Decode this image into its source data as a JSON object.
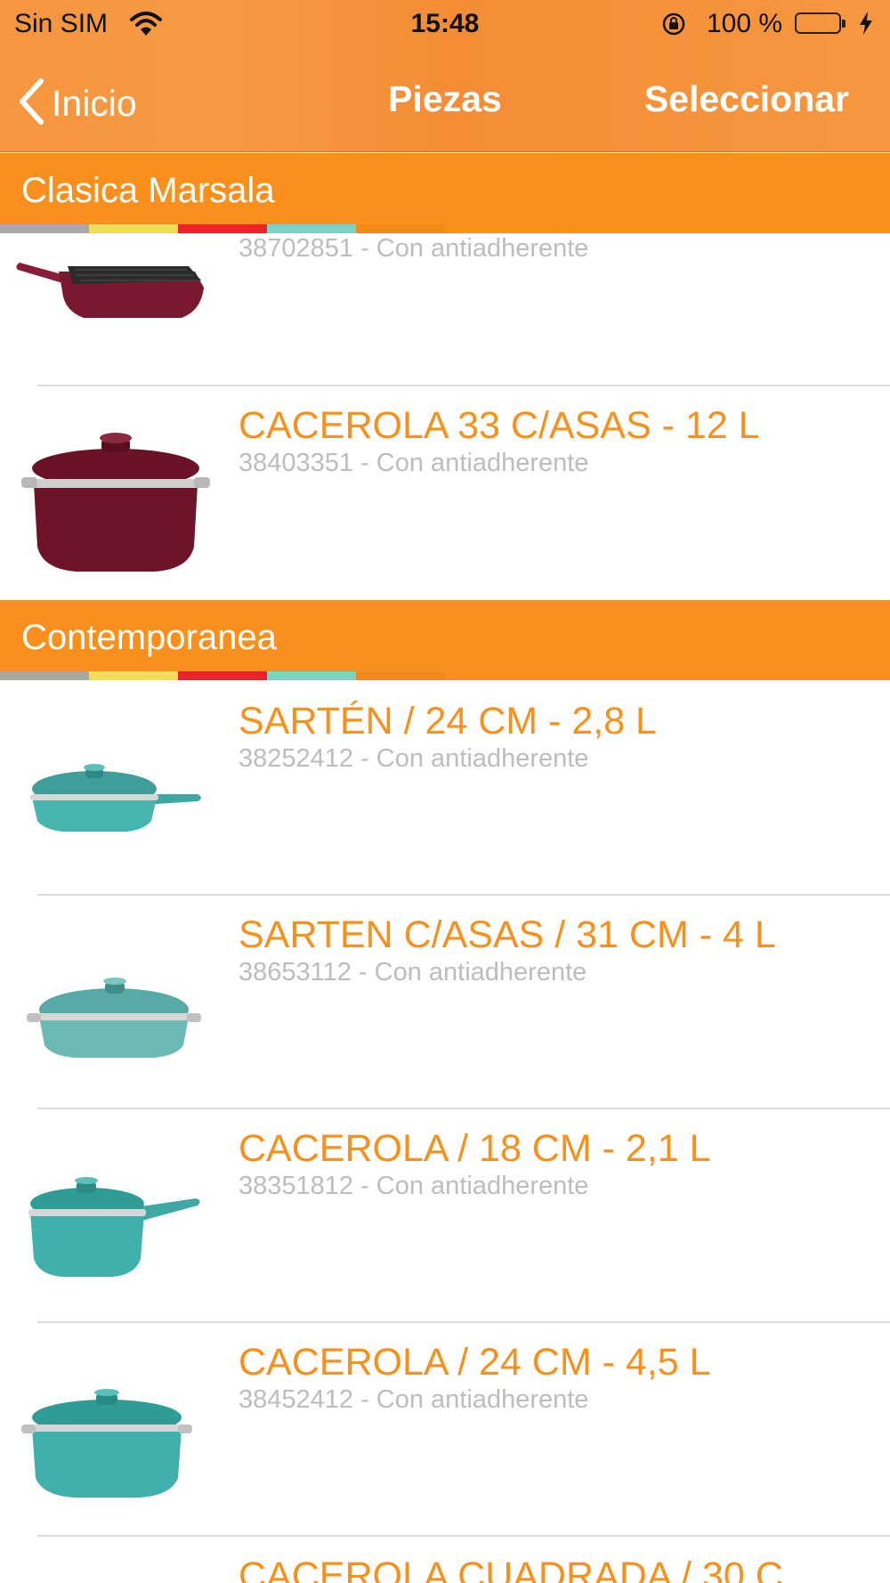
{
  "status_bar": {
    "carrier": "Sin SIM",
    "time": "15:48",
    "battery_percent": "100 %",
    "battery_level": 1.0
  },
  "nav": {
    "back_label": "Inicio",
    "title": "Piezas",
    "select_label": "Seleccionar"
  },
  "colors": {
    "accent": "#f9901d",
    "nav_bar": "#f6963f",
    "product_title": "#f7911e",
    "subtitle_gray": "#bdbdbd",
    "stripes": [
      "#a8a8a8",
      "#f2dc5d",
      "#e8232a",
      "#7fd0c6",
      "#f08a1c"
    ],
    "marsala_product": "#7a1830",
    "contemporanea_product": "#45b5ae"
  },
  "sections": [
    {
      "title": "Clasica Marsala",
      "items": [
        {
          "name": "",
          "code_note": "38702851 - Con antiadherente",
          "icon": "grill-pan-marsala-icon"
        },
        {
          "name": "CACEROLA 33 C/ASAS - 12 L",
          "code_note": "38403351 - Con antiadherente",
          "icon": "stockpot-marsala-icon"
        }
      ]
    },
    {
      "title": "Contemporanea",
      "items": [
        {
          "name": "SARTÉN / 24 CM - 2,8 L",
          "code_note": "38252412 - Con antiadherente",
          "icon": "saute-pan-teal-icon"
        },
        {
          "name": "SARTEN C/ASAS / 31 CM - 4 L",
          "code_note": "38653112 - Con antiadherente",
          "icon": "braiser-teal-icon"
        },
        {
          "name": "CACEROLA / 18 CM - 2,1 L",
          "code_note": "38351812 - Con antiadherente",
          "icon": "saucepan-teal-icon"
        },
        {
          "name": "CACEROLA / 24 CM - 4,5 L",
          "code_note": "38452412 - Con antiadherente",
          "icon": "casserole-teal-icon"
        },
        {
          "name": "CACEROLA CUADRADA / 30 C",
          "code_note": "",
          "icon": ""
        }
      ]
    }
  ]
}
